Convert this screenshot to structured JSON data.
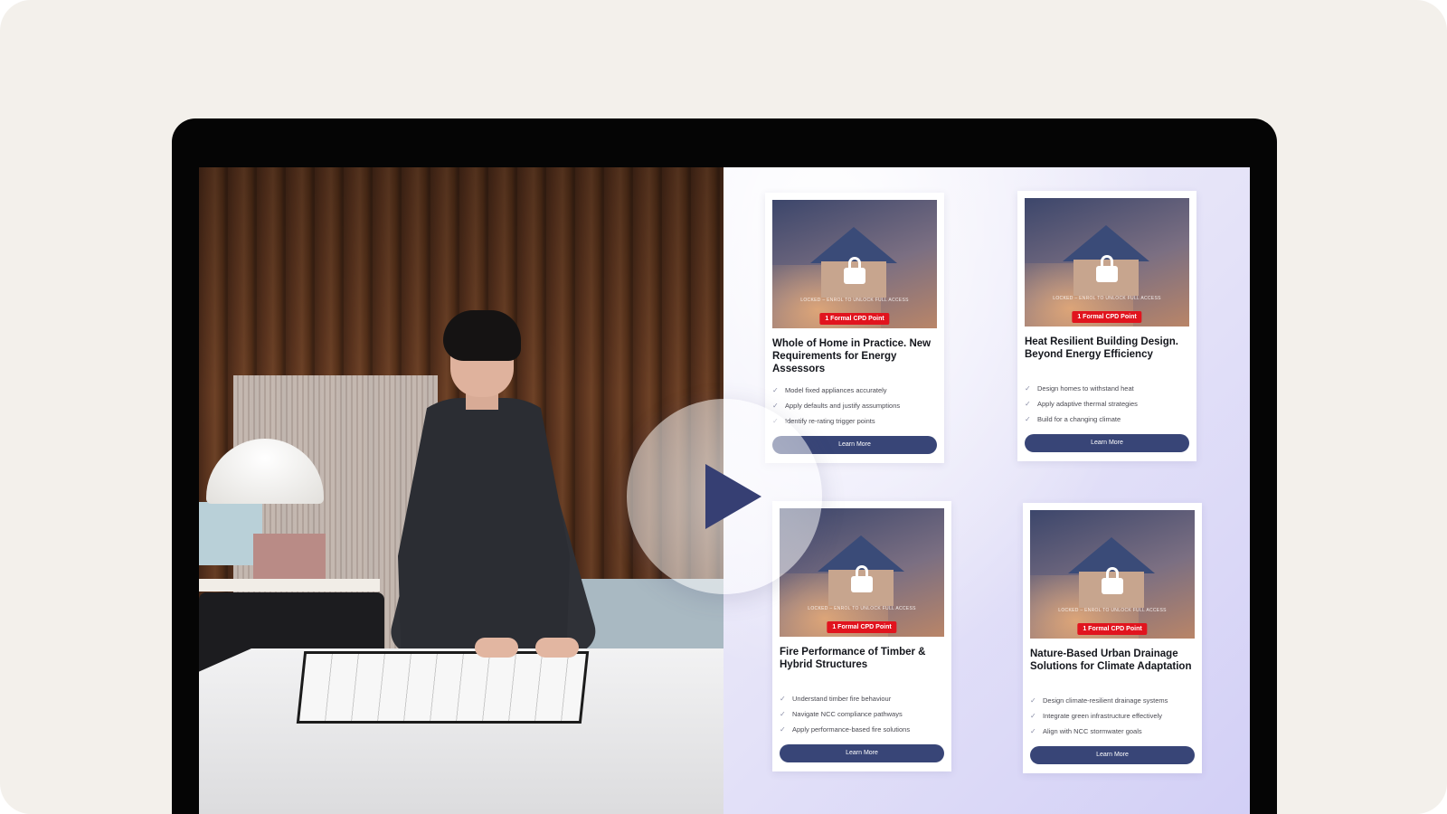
{
  "colors": {
    "outer_background": "#f3f0eb",
    "monitor_bezel": "#050505",
    "badge_red": "#e1141e",
    "button_navy": "#384577",
    "play_icon": "#363f73"
  },
  "play_button": {
    "icon": "play-icon"
  },
  "cards": [
    {
      "lock_caption": "LOCKED – ENROL TO UNLOCK FULL ACCESS",
      "badge": "1 Formal CPD Point",
      "title": "Whole of Home in Practice. New Requirements for Energy Assessors",
      "bullets": [
        "Model fixed appliances accurately",
        "Apply defaults and justify assumptions",
        "Identify re-rating trigger points"
      ],
      "button": "Learn More"
    },
    {
      "lock_caption": "LOCKED – ENROL TO UNLOCK FULL ACCESS",
      "badge": "1 Formal CPD Point",
      "title": "Heat Resilient Building Design. Beyond Energy Efficiency",
      "bullets": [
        "Design homes to withstand heat",
        "Apply adaptive thermal strategies",
        "Build for a changing climate"
      ],
      "button": "Learn More"
    },
    {
      "lock_caption": "LOCKED – ENROL TO UNLOCK FULL ACCESS",
      "badge": "1 Formal CPD Point",
      "title": "Fire Performance of Timber & Hybrid Structures",
      "bullets": [
        "Understand timber fire behaviour",
        "Navigate NCC compliance pathways",
        "Apply performance-based fire solutions"
      ],
      "button": "Learn More"
    },
    {
      "lock_caption": "LOCKED – ENROL TO UNLOCK FULL ACCESS",
      "badge": "1 Formal CPD Point",
      "title": "Nature-Based Urban Drainage Solutions for Climate Adaptation",
      "bullets": [
        "Design climate-resilient drainage systems",
        "Integrate green infrastructure effectively",
        "Align with NCC stormwater goals"
      ],
      "button": "Learn More"
    }
  ]
}
